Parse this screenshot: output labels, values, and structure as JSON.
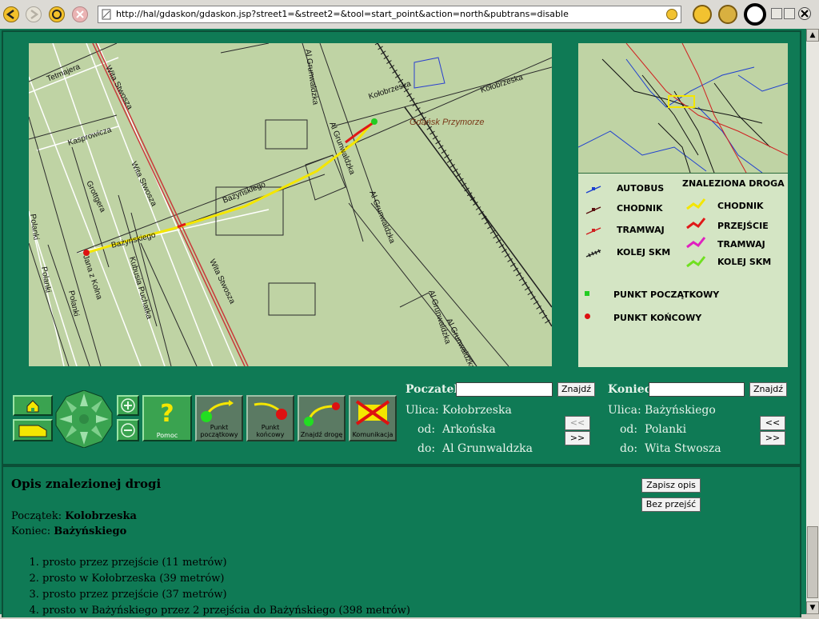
{
  "browser": {
    "url": "http://hal/gdaskon/gdaskon.jsp?street1=&street2=&tool=start_point&action=north&pubtrans=disable"
  },
  "map": {
    "streets": [
      {
        "name": "Tetmajera"
      },
      {
        "name": "Wita Stwosza"
      },
      {
        "name": "Al Grunwaldzka"
      },
      {
        "name": "Kołobrzeska"
      },
      {
        "name": "Gdańsk Przymorze"
      },
      {
        "name": "Kasprowicza"
      },
      {
        "name": "Wita Stwosza"
      },
      {
        "name": "Grottgera"
      },
      {
        "name": "Al Grunwaldzka"
      },
      {
        "name": "Bażyńskiego"
      },
      {
        "name": "Bażyńskiego"
      },
      {
        "name": "Polanki"
      },
      {
        "name": "Jana z Kolna"
      },
      {
        "name": "Kubusia Puchatka"
      },
      {
        "name": "Al Grunwaldzka"
      },
      {
        "name": "Polanki"
      },
      {
        "name": "Polanki"
      },
      {
        "name": "Wita Stwosza"
      },
      {
        "name": "Al Grunwaldzka"
      },
      {
        "name": "Kołobrzeska"
      },
      {
        "name": "Al Grunwaldzka"
      }
    ]
  },
  "legend": {
    "title": "ZNALEZIONA DROGA",
    "left_items": [
      "AUTOBUS",
      "CHODNIK",
      "TRAMWAJ",
      "KOLEJ SKM"
    ],
    "right_items": [
      "CHODNIK",
      "PRZEJŚCIE",
      "TRAMWAJ",
      "KOLEJ SKM"
    ],
    "start": "PUNKT POCZĄTKOWY",
    "end": "PUNKT KOŃCOWY",
    "colors": {
      "autobus": "#1a3fd0",
      "chodnik": "#5a1010",
      "tramwaj": "#d02020",
      "skm": "#202020",
      "r_chodnik": "#f4e600",
      "r_przejscie": "#e01818",
      "r_tramwaj": "#e020c0",
      "r_skm": "#70e020",
      "start": "#22cc22",
      "end": "#dd1111"
    }
  },
  "buttons": {
    "pomoc": "Pomoc",
    "start_point": [
      "Punkt",
      "początkowy"
    ],
    "end_point": [
      "Punkt",
      "końcowy"
    ],
    "find_route": "Znajdź drogę",
    "transport": "Komunikacja"
  },
  "form": {
    "start": {
      "label": "Poczatek",
      "input_value": "",
      "find": "Znajdź",
      "ulica_label": "Ulica:",
      "od_label": "od:",
      "do_label": "do:",
      "ulica": "Kołobrzeska",
      "od": "Arkońska",
      "do": "Al Grunwaldzka",
      "prev": "<<",
      "next": ">>"
    },
    "end": {
      "label": "Koniec",
      "input_value": "",
      "find": "Znajdź",
      "ulica_label": "Ulica:",
      "od_label": "od:",
      "do_label": "do:",
      "ulica": "Bażyńskiego",
      "od": "Polanki",
      "do": "Wita Stwosza",
      "prev": "<<",
      "next": ">>"
    }
  },
  "description": {
    "title": "Opis znalezionej drogi",
    "save": "Zapisz opis",
    "no_crossings": "Bez przejść",
    "start_label": "Początek:",
    "start_value": "Kolobrzeska",
    "end_label": "Koniec:",
    "end_value": "Bażyńskiego",
    "steps": [
      "prosto przez przejście (11 metrów)",
      "prosto w Kołobrzeska (39 metrów)",
      "prosto przez przejście (37 metrów)",
      "prosto w Bażyńskiego przez 2 przejścia do Bażyńskiego (398 metrów)"
    ]
  }
}
